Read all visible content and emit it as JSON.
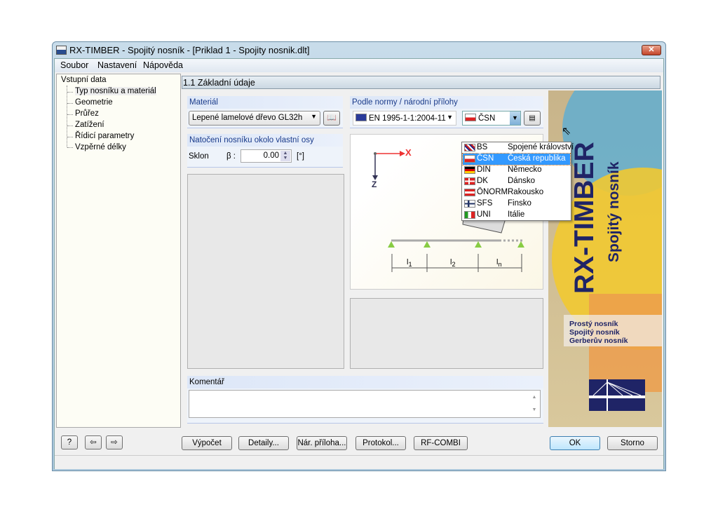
{
  "window": {
    "title": "RX-TIMBER - Spojitý nosník - [Priklad 1 - Spojity nosnik.dlt]",
    "close": "✕"
  },
  "menu": [
    "Soubor",
    "Nastavení",
    "Nápověda"
  ],
  "tree": {
    "root": "Vstupní data",
    "items": [
      "Typ nosníku a materiál",
      "Geometrie",
      "Průřez",
      "Zatížení",
      "Řídicí parametry",
      "Vzpěrné délky"
    ]
  },
  "header": "1.1 Základní údaje",
  "material": {
    "label": "Materiál",
    "value": "Lepené lamelové dřevo GL32h"
  },
  "rotation": {
    "label": "Natočení nosníku okolo vlastní osy",
    "sklon": "Sklon",
    "beta": "β :",
    "value": "0.00",
    "unit": "[°]"
  },
  "norm": {
    "label": "Podle normy / národní přílohy",
    "standard": "EN 1995-1-1:2004-11",
    "annex": "ČSN",
    "options": [
      {
        "code": "BS",
        "name": "Spojené království"
      },
      {
        "code": "ČSN",
        "name": "Česká republika"
      },
      {
        "code": "DIN",
        "name": "Německo"
      },
      {
        "code": "DK",
        "name": "Dánsko"
      },
      {
        "code": "ÖNORM",
        "name": "Rakousko"
      },
      {
        "code": "SFS",
        "name": "Finsko"
      },
      {
        "code": "UNI",
        "name": "Itálie"
      }
    ]
  },
  "diagram": {
    "x": "X",
    "z": "Z",
    "l1": "l",
    "s1": "1",
    "l2": "l",
    "s2": "2",
    "ln": "l",
    "sn": "n"
  },
  "comment": {
    "label": "Komentář",
    "value": ""
  },
  "brand": {
    "title": "RX-TIMBER",
    "subtitle": "Spojitý nosník",
    "types": [
      "Prostý nosník",
      "Spojitý nosník",
      "Gerberův nosník"
    ]
  },
  "buttons": {
    "calc": "Výpočet",
    "details": "Detaily...",
    "annex": "Nár. příloha...",
    "protocol": "Protokol...",
    "rfcombi": "RF-COMBI",
    "ok": "OK",
    "cancel": "Storno"
  },
  "colors": {
    "accent": "#3399ff",
    "brand_navy": "#1f2466"
  }
}
